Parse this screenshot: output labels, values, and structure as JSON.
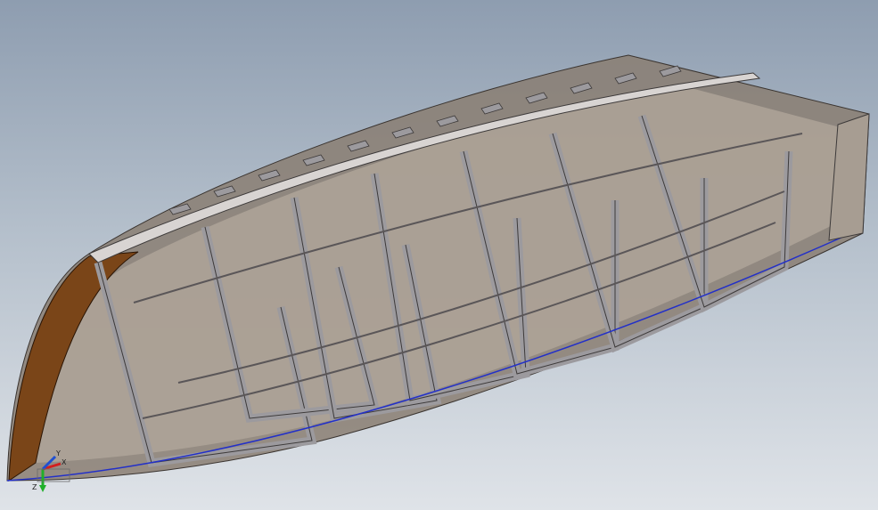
{
  "viewport": {
    "background_top": "#8e9db0",
    "background_bottom": "#dfe3e8",
    "model_name": "boat-hull-frame-assembly"
  },
  "colors": {
    "hull_skin": "#8a7e72",
    "hull_skin_light": "#b3a89c",
    "frame": "#9c9a9e",
    "frame_edge": "#3d3a3a",
    "stem": "#7a4518",
    "sheer_line": "#2330c8"
  },
  "triad": {
    "x_label": "X",
    "y_label": "Y",
    "z_label": "Z",
    "x_color": "#d21f1f",
    "y_color": "#1f4fd2",
    "z_color": "#1fb02a",
    "icon": "coordinate-triad-icon"
  }
}
